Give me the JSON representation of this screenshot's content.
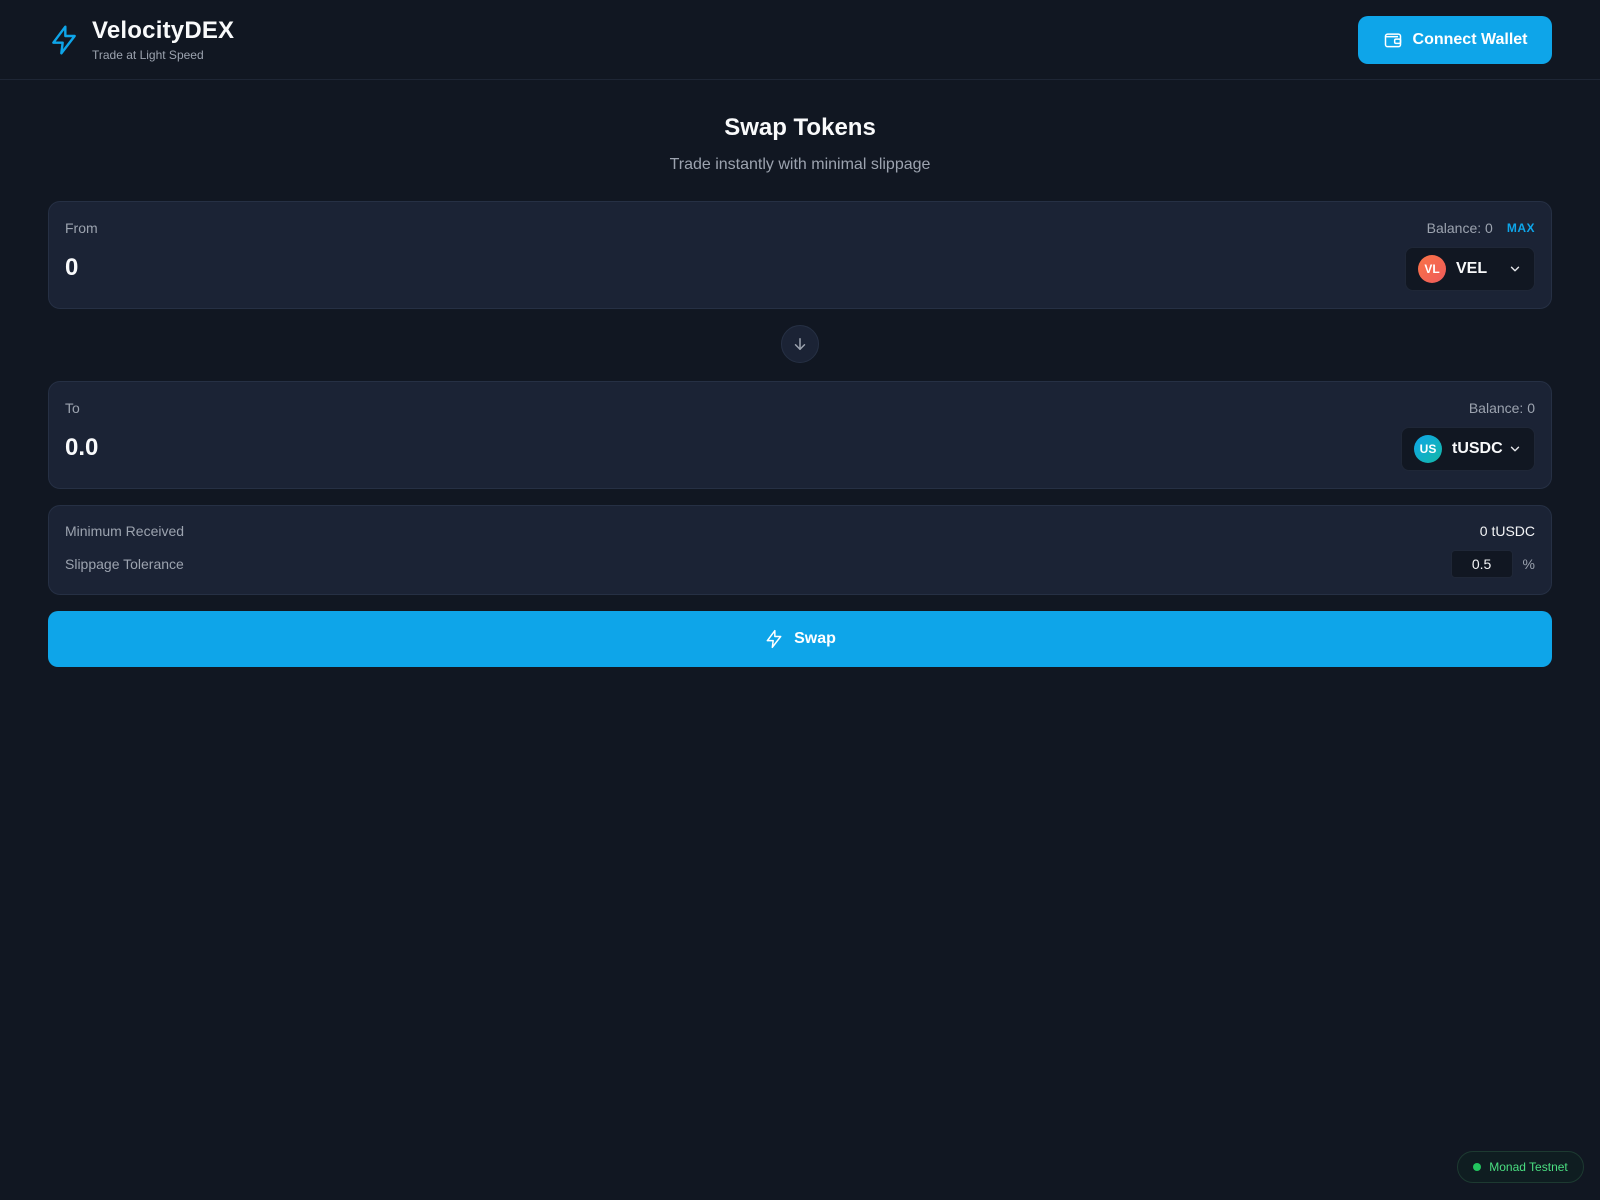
{
  "header": {
    "brand_title": "VelocityDEX",
    "brand_subtitle": "Trade at Light Speed",
    "connect_label": "Connect Wallet",
    "logo_icon": "lightning-bolt-icon"
  },
  "main": {
    "title": "Swap Tokens",
    "subtitle": "Trade instantly with minimal slippage"
  },
  "from": {
    "label": "From",
    "balance": "Balance: 0",
    "max_label": "MAX",
    "amount": "0",
    "token": {
      "badge": "VL",
      "symbol": "VEL"
    }
  },
  "to": {
    "label": "To",
    "balance": "Balance: 0",
    "amount": "0.0",
    "token": {
      "badge": "US",
      "symbol": "tUSDC"
    }
  },
  "details": {
    "min_received_label": "Minimum Received",
    "min_received_value": "0 tUSDC",
    "slippage_label": "Slippage Tolerance",
    "slippage_value": "0.5",
    "slippage_unit": "%"
  },
  "swap": {
    "label": "Swap"
  },
  "network": {
    "label": "Monad Testnet"
  },
  "colors": {
    "accent": "#0ea5e9",
    "background": "#111722",
    "card": "#1b2335",
    "network_status": "#22c55e"
  }
}
